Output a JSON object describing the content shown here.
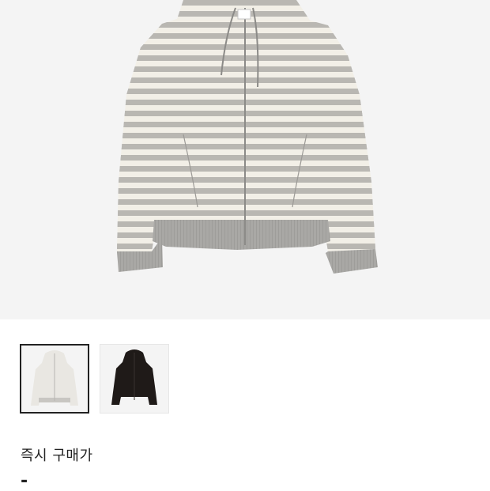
{
  "product": {
    "images": [
      {
        "icon": "striped-zip-hoodie",
        "color": "gray-white-stripe",
        "selected": true
      },
      {
        "icon": "black-zip-hoodie",
        "color": "black",
        "selected": false
      }
    ]
  },
  "price": {
    "label": "즉시 구매가",
    "value": "-"
  },
  "colors": {
    "stripe_gray": "#b9b7b2",
    "stripe_white": "#f2efe7",
    "rib_gray": "#a9a8a5",
    "dark_garment": "#1f1a18"
  }
}
